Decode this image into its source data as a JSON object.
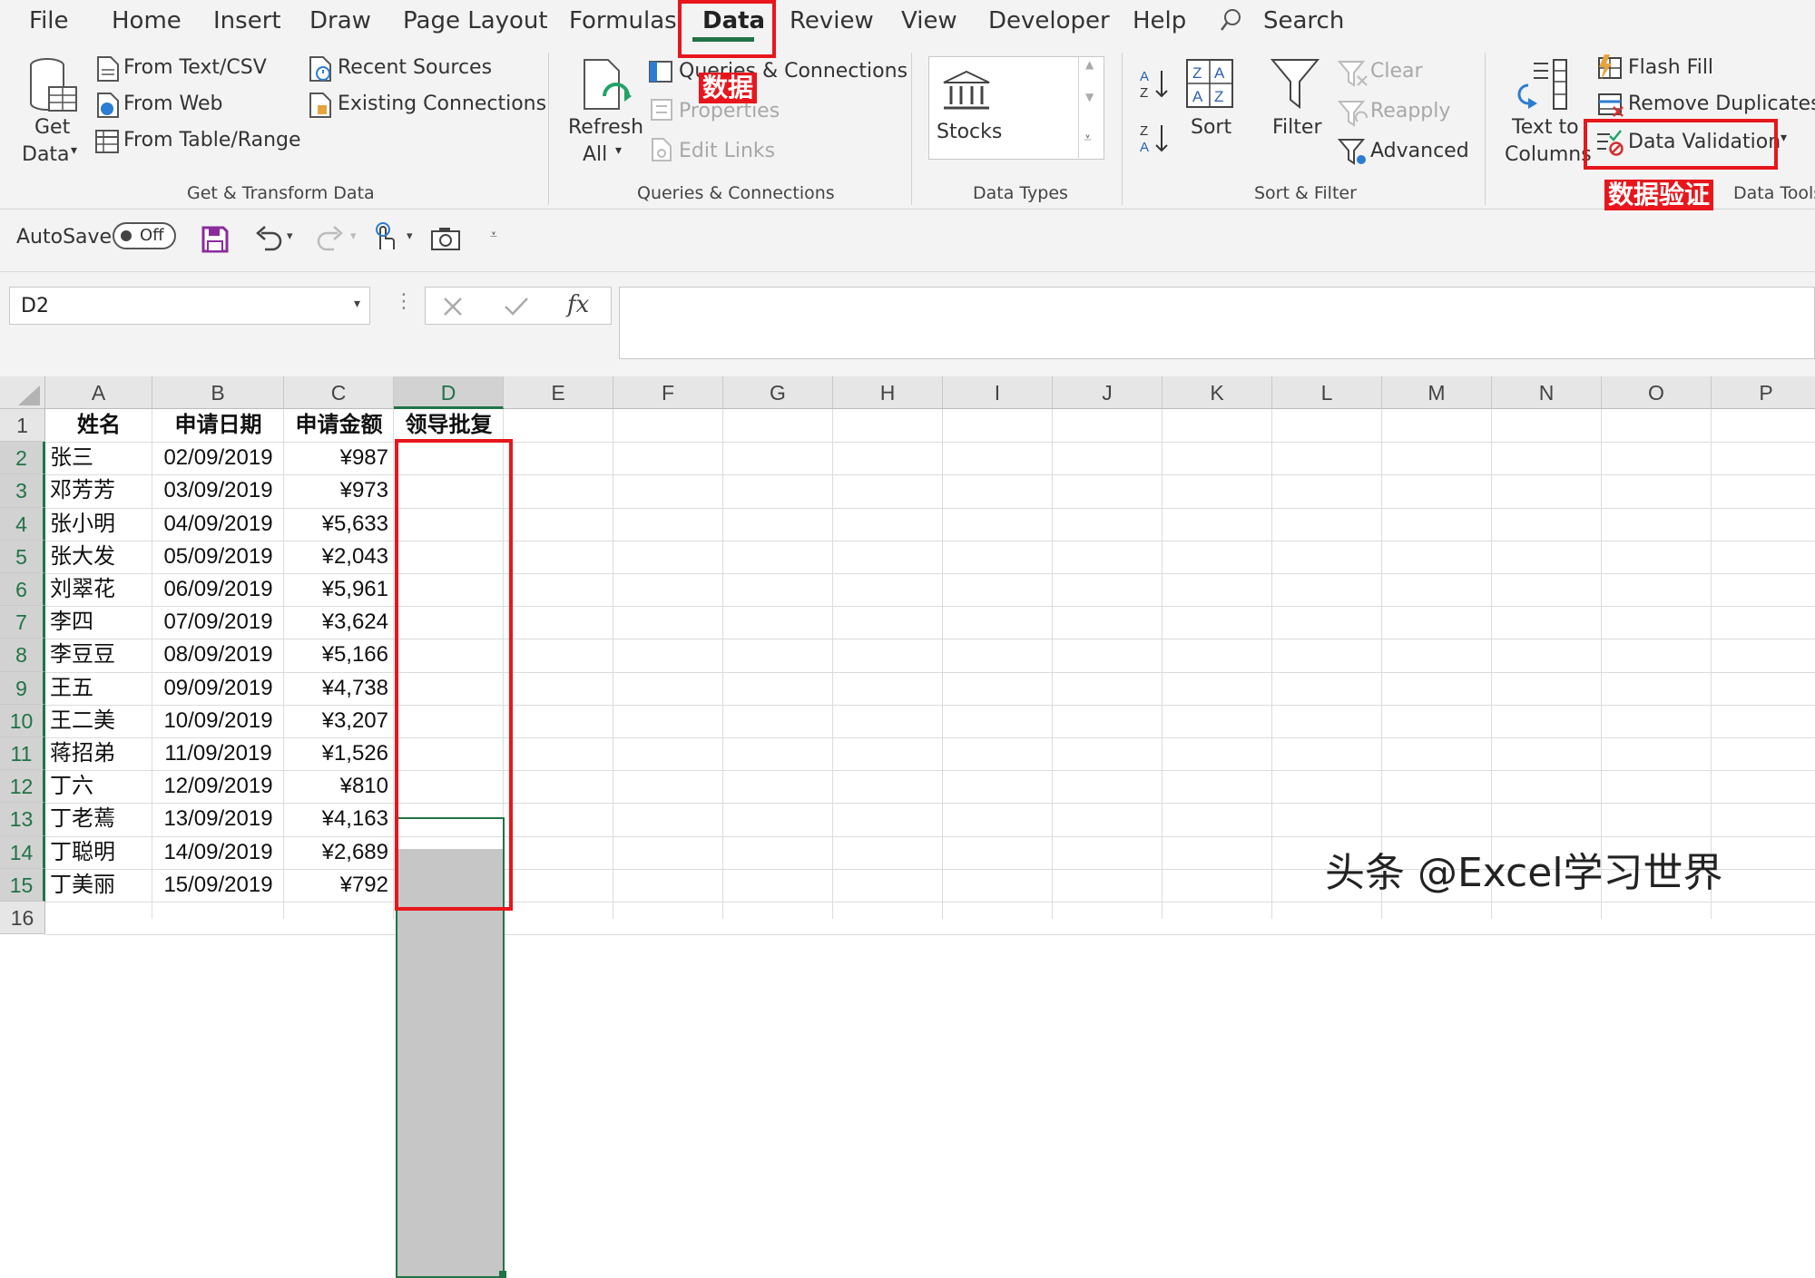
{
  "ribbon_tabs": [
    "File",
    "Home",
    "Insert",
    "Draw",
    "Page Layout",
    "Formulas",
    "Data",
    "Review",
    "View",
    "Developer",
    "Help"
  ],
  "active_tab": "Data",
  "search_label": "Search",
  "get_transform": {
    "get_data": [
      "Get",
      "Data"
    ],
    "from_text_csv": "From Text/CSV",
    "from_web": "From Web",
    "from_table_range": "From Table/Range",
    "recent_sources": "Recent Sources",
    "existing_connections": "Existing Connections",
    "group_label": "Get & Transform Data"
  },
  "queries": {
    "refresh_all": [
      "Refresh",
      "All"
    ],
    "queries_connections": "Queries & Connections",
    "properties": "Properties",
    "edit_links": "Edit Links",
    "group_label": "Queries & Connections"
  },
  "data_types": {
    "stocks": "Stocks",
    "group_label": "Data Types"
  },
  "sort_filter": {
    "sort": "Sort",
    "filter": "Filter",
    "clear": "Clear",
    "reapply": "Reapply",
    "advanced": "Advanced",
    "group_label": "Sort & Filter"
  },
  "data_tools": {
    "text_to_columns": [
      "Text to",
      "Columns"
    ],
    "flash_fill": "Flash Fill",
    "remove_duplicates": "Remove Duplicates",
    "data_validation": "Data Validation",
    "group_label": "Data Tools"
  },
  "qat": {
    "autosave": "AutoSave",
    "toggle": "Off"
  },
  "formula_bar": {
    "name_box": "D2",
    "fx": "fx",
    "formula": ""
  },
  "annotations": {
    "data_tab_cn": "数据",
    "data_validation_cn": "数据验证"
  },
  "columns": [
    "A",
    "B",
    "C",
    "D",
    "E",
    "F",
    "G",
    "H",
    "I",
    "J",
    "K",
    "L",
    "M",
    "N",
    "O",
    "P"
  ],
  "rows": [
    "1",
    "2",
    "3",
    "4",
    "5",
    "6",
    "7",
    "8",
    "9",
    "10",
    "11",
    "12",
    "13",
    "14",
    "15",
    "16"
  ],
  "sheet": {
    "headers": [
      "姓名",
      "申请日期",
      "申请金额",
      "领导批复"
    ],
    "records": [
      {
        "name": "张三",
        "date": "02/09/2019",
        "amount": "¥987"
      },
      {
        "name": "邓芳芳",
        "date": "03/09/2019",
        "amount": "¥973"
      },
      {
        "name": "张小明",
        "date": "04/09/2019",
        "amount": "¥5,633"
      },
      {
        "name": "张大发",
        "date": "05/09/2019",
        "amount": "¥2,043"
      },
      {
        "name": "刘翠花",
        "date": "06/09/2019",
        "amount": "¥5,961"
      },
      {
        "name": "李四",
        "date": "07/09/2019",
        "amount": "¥3,624"
      },
      {
        "name": "李豆豆",
        "date": "08/09/2019",
        "amount": "¥5,166"
      },
      {
        "name": "王五",
        "date": "09/09/2019",
        "amount": "¥4,738"
      },
      {
        "name": "王二美",
        "date": "10/09/2019",
        "amount": "¥3,207"
      },
      {
        "name": "蒋招弟",
        "date": "11/09/2019",
        "amount": "¥1,526"
      },
      {
        "name": "丁六",
        "date": "12/09/2019",
        "amount": "¥810"
      },
      {
        "name": "丁老蔫",
        "date": "13/09/2019",
        "amount": "¥4,163"
      },
      {
        "name": "丁聪明",
        "date": "14/09/2019",
        "amount": "¥2,689"
      },
      {
        "name": "丁美丽",
        "date": "15/09/2019",
        "amount": "¥792"
      }
    ]
  },
  "selected_range": "D2:D15",
  "watermark": "头条 @Excel学习世界",
  "colors": {
    "accent": "#217346",
    "annotation_red": "#e8161c",
    "selection_fill": "#c6c6c6"
  },
  "icons": [
    "search-icon",
    "get-data-icon",
    "text-csv-icon",
    "web-icon",
    "table-icon",
    "recent-sources-icon",
    "existing-connections-icon",
    "refresh-icon",
    "queries-icon",
    "properties-icon",
    "edit-links-icon",
    "stocks-icon",
    "sort-az-icon",
    "sort-za-icon",
    "sort-icon",
    "filter-icon",
    "clear-icon",
    "reapply-icon",
    "advanced-icon",
    "text-to-columns-icon",
    "flash-fill-icon",
    "remove-duplicates-icon",
    "data-validation-icon",
    "save-icon",
    "undo-icon",
    "redo-icon",
    "touch-mode-icon",
    "camera-icon"
  ]
}
